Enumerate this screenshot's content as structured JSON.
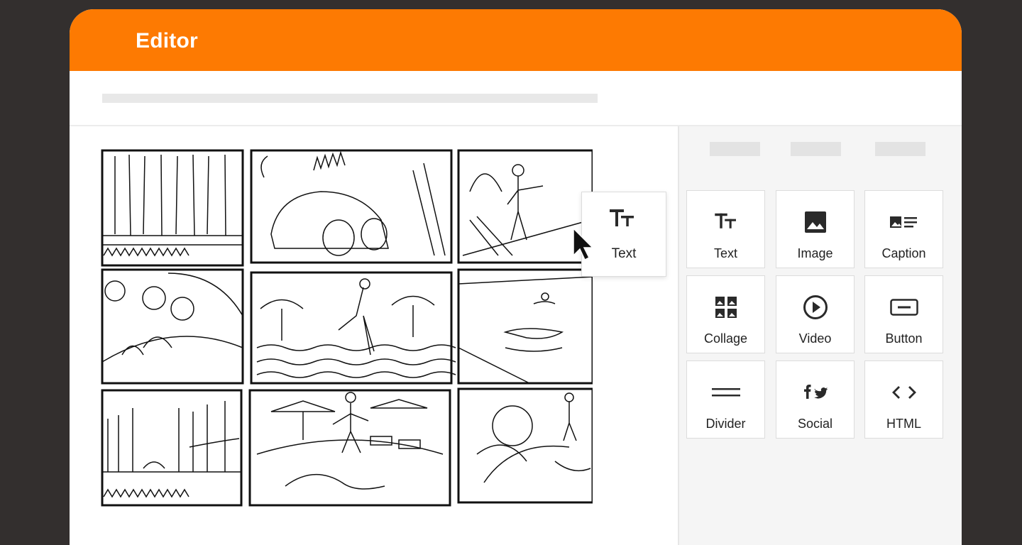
{
  "window": {
    "title": "Editor"
  },
  "drag_tile": {
    "icon": "text-format-icon",
    "label": "Text"
  },
  "sidebar": {
    "blocks": [
      {
        "id": "text",
        "label": "Text",
        "icon": "text-format-icon"
      },
      {
        "id": "image",
        "label": "Image",
        "icon": "image-icon"
      },
      {
        "id": "caption",
        "label": "Caption",
        "icon": "caption-icon"
      },
      {
        "id": "collage",
        "label": "Collage",
        "icon": "collage-icon"
      },
      {
        "id": "video",
        "label": "Video",
        "icon": "play-circle-icon"
      },
      {
        "id": "button",
        "label": "Button",
        "icon": "button-icon"
      },
      {
        "id": "divider",
        "label": "Divider",
        "icon": "divider-icon"
      },
      {
        "id": "social",
        "label": "Social",
        "icon": "social-icon"
      },
      {
        "id": "html",
        "label": "HTML",
        "icon": "code-icon"
      }
    ]
  },
  "colors": {
    "accent": "#fd7a02",
    "background": "#332f2e",
    "icon": "#2a2a2a"
  }
}
